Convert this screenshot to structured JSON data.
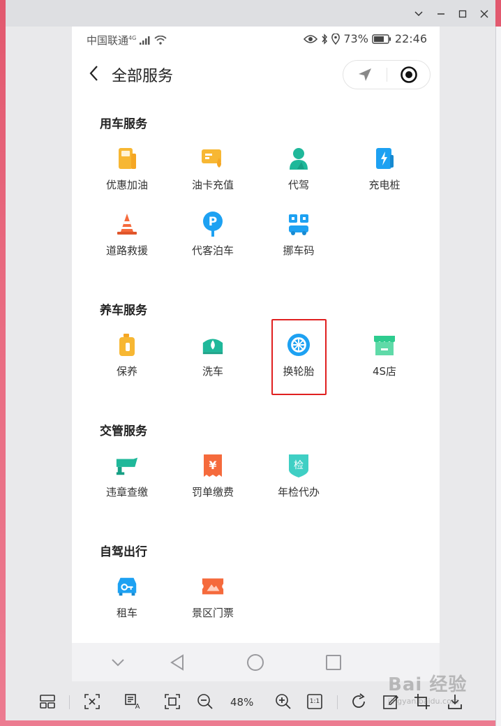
{
  "window": {
    "controls": [
      "chevron-down-icon",
      "minimize-icon",
      "maximize-icon",
      "close-icon"
    ]
  },
  "status_bar": {
    "carrier": "中国联通",
    "network": "4G",
    "battery": "73%",
    "time": "22:46"
  },
  "header": {
    "title": "全部服务"
  },
  "sections": [
    {
      "title": "用车服务",
      "items": [
        {
          "label": "优惠加油",
          "icon": "fuel-pump-icon",
          "color": "#f5a623"
        },
        {
          "label": "油卡充值",
          "icon": "fuel-card-icon",
          "color": "#f5a623"
        },
        {
          "label": "代驾",
          "icon": "driver-icon",
          "color": "#1fb89a"
        },
        {
          "label": "充电桩",
          "icon": "charging-pile-icon",
          "color": "#1da1f2"
        },
        {
          "label": "道路救援",
          "icon": "traffic-cone-icon",
          "color": "#f56a3c"
        },
        {
          "label": "代客泊车",
          "icon": "parking-icon",
          "color": "#1da1f2"
        },
        {
          "label": "挪车码",
          "icon": "move-car-code-icon",
          "color": "#1da1f2"
        }
      ]
    },
    {
      "title": "养车服务",
      "items": [
        {
          "label": "保养",
          "icon": "oil-can-icon",
          "color": "#f5a623"
        },
        {
          "label": "洗车",
          "icon": "car-wash-icon",
          "color": "#1fb89a"
        },
        {
          "label": "换轮胎",
          "icon": "tire-icon",
          "color": "#1da1f2"
        },
        {
          "label": "4S店",
          "icon": "shop-icon",
          "color": "#2ecc8f"
        }
      ]
    },
    {
      "title": "交管服务",
      "items": [
        {
          "label": "违章查缴",
          "icon": "camera-icon",
          "color": "#1fb89a"
        },
        {
          "label": "罚单缴费",
          "icon": "ticket-yen-icon",
          "color": "#f56a3c"
        },
        {
          "label": "年检代办",
          "icon": "inspection-badge-icon",
          "color": "#1fb89a",
          "glyph": "检"
        }
      ]
    },
    {
      "title": "自驾出行",
      "items": [
        {
          "label": "租车",
          "icon": "rent-car-icon",
          "color": "#1da1f2"
        },
        {
          "label": "景区门票",
          "icon": "scenic-ticket-icon",
          "color": "#f56a3c"
        }
      ]
    }
  ],
  "toolbar": {
    "zoom": "48%",
    "actual_size": "1:1"
  },
  "watermark": {
    "text": "Bai 经验",
    "sub": "jingyan.baidu.com"
  }
}
